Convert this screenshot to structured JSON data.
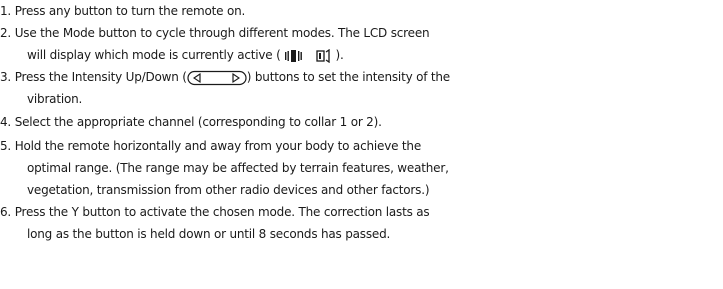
{
  "steps": [
    {
      "number": "1.",
      "lines": [
        "Press any button to turn the remote on."
      ]
    },
    {
      "number": "2.",
      "lines": [
        "Use the Mode button to cycle through different modes. The LCD screen",
        "will display which mode is currently active ("
      ],
      "line_end": ")."
    },
    {
      "number": "3.",
      "line1_start": "Press the Intensity Up/Down (",
      "line1_end": ") buttons to set the intensity of the",
      "lines_rest": [
        "vibration."
      ]
    },
    {
      "number": "4.",
      "lines": [
        "Select the appropriate channel (corresponding to collar 1 or 2)."
      ]
    },
    {
      "number": "5.",
      "lines": [
        "Hold the remote horizontally and away from your body to achieve the",
        "optimal range. (The range may be affected by terrain features, weather,",
        "vegetation, transmission from other radio devices and other factors.)"
      ]
    },
    {
      "number": "6.",
      "lines": [
        "Press the Y button to activate the chosen mode. The correction lasts as",
        "long as the button is held down or until 8 seconds has passed."
      ]
    }
  ],
  "icons": {
    "mode_icons": [
      "vibration-mode-icon",
      "tone-mode-icon"
    ],
    "intensity_icon": "intensity-up-down-icon"
  }
}
